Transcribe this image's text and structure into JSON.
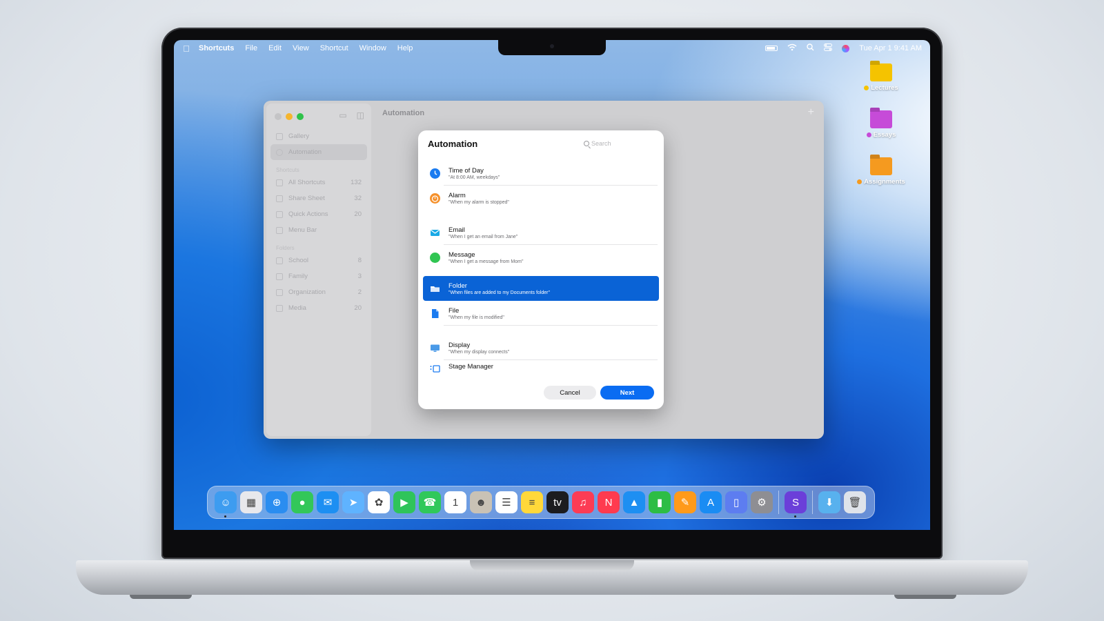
{
  "menubar": {
    "app_name": "Shortcuts",
    "menus": [
      "File",
      "Edit",
      "View",
      "Shortcut",
      "Window",
      "Help"
    ],
    "clock": "Tue Apr 1  9:41 AM"
  },
  "desktop": {
    "items": [
      {
        "label": "Lectures",
        "color": "#f5c300"
      },
      {
        "label": "Essays",
        "color": "#c64bd8"
      },
      {
        "label": "Assignments",
        "color": "#f59a1f"
      }
    ]
  },
  "window": {
    "title": "Automation",
    "sidebar": {
      "top": [
        {
          "label": "Gallery"
        },
        {
          "label": "Automation"
        }
      ],
      "shortcuts_header": "Shortcuts",
      "shortcuts": [
        {
          "label": "All Shortcuts",
          "count": "132"
        },
        {
          "label": "Share Sheet",
          "count": "32"
        },
        {
          "label": "Quick Actions",
          "count": "20"
        },
        {
          "label": "Menu Bar",
          "count": ""
        }
      ],
      "folders_header": "Folders",
      "folders": [
        {
          "label": "School",
          "count": "8"
        },
        {
          "label": "Family",
          "count": "3"
        },
        {
          "label": "Organization",
          "count": "2"
        },
        {
          "label": "Media",
          "count": "20"
        }
      ]
    }
  },
  "dialog": {
    "title": "Automation",
    "search_placeholder": "Search",
    "rows": [
      {
        "name": "Time of Day",
        "desc": "\"At 8:00 AM, weekdays\"",
        "icon": "clock-icon",
        "color": "#1a7bf0"
      },
      {
        "name": "Alarm",
        "desc": "\"When my alarm is stopped\"",
        "icon": "alarm-icon",
        "color": "#f5902a"
      },
      {
        "name": "Email",
        "desc": "\"When I get an email from Jane\"",
        "icon": "mail-icon",
        "color": "#1aa9e6"
      },
      {
        "name": "Message",
        "desc": "\"When I get a message from Mom\"",
        "icon": "message-icon",
        "color": "#30c552"
      },
      {
        "name": "Folder",
        "desc": "\"When files are added to my Documents folder\"",
        "icon": "folder-icon",
        "color": "#ffffff"
      },
      {
        "name": "File",
        "desc": "\"When my file is modified\"",
        "icon": "file-icon",
        "color": "#1a7bf0"
      },
      {
        "name": "Display",
        "desc": "\"When my display connects\"",
        "icon": "display-icon",
        "color": "#4a9ae8"
      },
      {
        "name": "Stage Manager",
        "desc": "",
        "icon": "stage-manager-icon",
        "color": "#1a7bf0"
      }
    ],
    "cancel_label": "Cancel",
    "next_label": "Next"
  },
  "dock": {
    "apps": [
      {
        "name": "finder-icon",
        "color": "#3d9cf0",
        "glyph": "☺"
      },
      {
        "name": "launchpad-icon",
        "color": "#e8e8ec",
        "glyph": "▦"
      },
      {
        "name": "safari-icon",
        "color": "#2a8df0",
        "glyph": "⊕"
      },
      {
        "name": "messages-icon",
        "color": "#33c759",
        "glyph": "●"
      },
      {
        "name": "mail-app-icon",
        "color": "#1d8ff2",
        "glyph": "✉"
      },
      {
        "name": "maps-icon",
        "color": "#5fb3ff",
        "glyph": "➤"
      },
      {
        "name": "photos-icon",
        "color": "#ffffff",
        "glyph": "✿"
      },
      {
        "name": "facetime-icon",
        "color": "#2fc45a",
        "glyph": "▶"
      },
      {
        "name": "phone-icon",
        "color": "#30c85a",
        "glyph": "☎"
      },
      {
        "name": "calendar-icon",
        "color": "#ffffff",
        "glyph": "1"
      },
      {
        "name": "contacts-icon",
        "color": "#c9c2b5",
        "glyph": "☻"
      },
      {
        "name": "reminders-icon",
        "color": "#ffffff",
        "glyph": "☰"
      },
      {
        "name": "notes-icon",
        "color": "#ffd83a",
        "glyph": "≡"
      },
      {
        "name": "tv-icon",
        "color": "#1c1c1e",
        "glyph": "tv"
      },
      {
        "name": "music-icon",
        "color": "#fc3c55",
        "glyph": "♫"
      },
      {
        "name": "news-icon",
        "color": "#ff3b4f",
        "glyph": "N"
      },
      {
        "name": "keynote-icon",
        "color": "#1d8ff2",
        "glyph": "▲"
      },
      {
        "name": "numbers-icon",
        "color": "#2dbd45",
        "glyph": "▮"
      },
      {
        "name": "pages-icon",
        "color": "#ff9a1a",
        "glyph": "✎"
      },
      {
        "name": "app-store-icon",
        "color": "#1a8cf3",
        "glyph": "A"
      },
      {
        "name": "iphone-mirroring-icon",
        "color": "#5d7df0",
        "glyph": "▯"
      },
      {
        "name": "system-settings-icon",
        "color": "#8e8e93",
        "glyph": "⚙"
      },
      {
        "name": "shortcuts-app-icon",
        "color": "#6b3fd9",
        "glyph": "S"
      },
      {
        "name": "downloads-folder-icon",
        "color": "#58b1ee",
        "glyph": "⬇"
      },
      {
        "name": "trash-icon",
        "color": "#dfe3ea",
        "glyph": "🗑"
      }
    ]
  }
}
